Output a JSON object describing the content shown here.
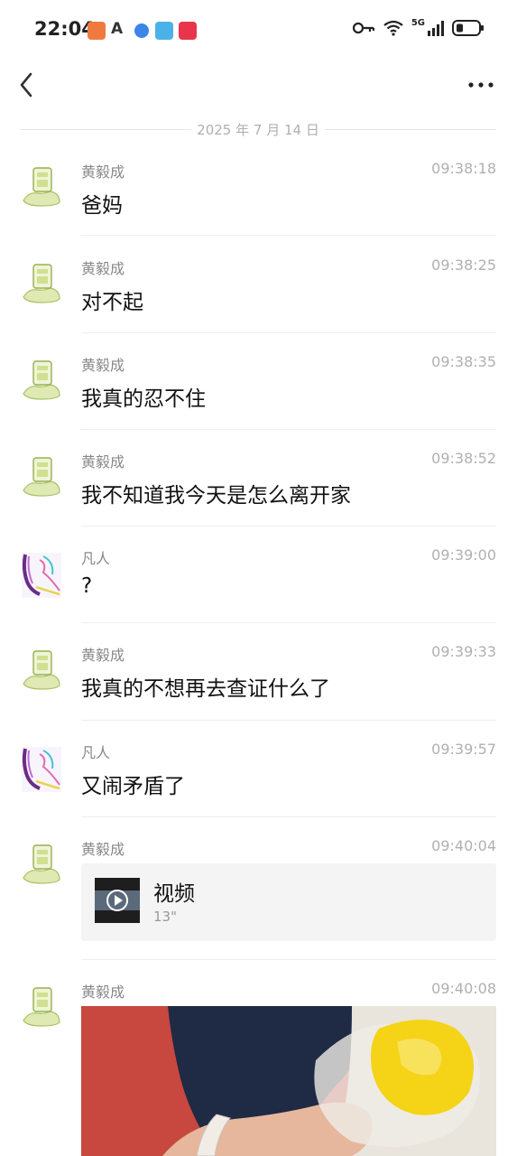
{
  "status": {
    "time": "22:04",
    "network": "5G",
    "app_icons": [
      "shield-icon",
      "a-icon",
      "globe-icon",
      "book-icon",
      "play-icon"
    ]
  },
  "nav": {
    "back": "back",
    "more": "more"
  },
  "date_separator": "2025 年 7 月 14 日",
  "messages": [
    {
      "sender": "黄毅成",
      "time": "09:38:18",
      "text": "爸妈"
    },
    {
      "sender": "黄毅成",
      "time": "09:38:25",
      "text": "对不起"
    },
    {
      "sender": "黄毅成",
      "time": "09:38:35",
      "text": "我真的忍不住"
    },
    {
      "sender": "黄毅成",
      "time": "09:38:52",
      "text": "我不知道我今天是怎么离开家"
    },
    {
      "sender": "凡人",
      "time": "09:39:00",
      "text": "?"
    },
    {
      "sender": "黄毅成",
      "time": "09:39:33",
      "text": "我真的不想再去查证什么了"
    },
    {
      "sender": "凡人",
      "time": "09:39:57",
      "text": "又闹矛盾了"
    },
    {
      "sender": "黄毅成",
      "time": "09:40:04",
      "video": {
        "label": "视频",
        "duration": "13\""
      }
    },
    {
      "sender": "黄毅成",
      "time": "09:40:08",
      "image": "photo"
    }
  ],
  "colors": {
    "accent_green": "#c7d98c",
    "divider": "#eeeeee",
    "muted": "#b0b0b0"
  }
}
